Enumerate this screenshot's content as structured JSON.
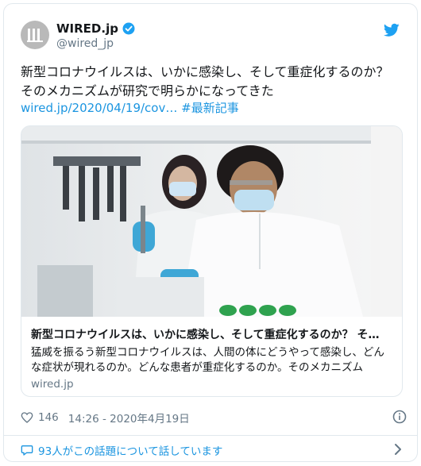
{
  "author": {
    "display_name": "WIRED.jp",
    "handle": "@wired_jp",
    "avatar_icon": "wired-logo-icon",
    "verified_icon": "verified-badge-icon"
  },
  "platform_icon": "twitter-bird-icon",
  "tweet": {
    "line1": "新型コロナウイルスは、いかに感染し、そして重症化するのか？",
    "line2": "そのメカニズムが研究で明らかになってきた",
    "link": "wired.jp/2020/04/19/cov…",
    "hashtag": "#最新記事"
  },
  "card": {
    "image_alt": "lab-researchers-photo",
    "title": "新型コロナウイルスは、いかに感染し、そして重症化するのか？ そ…",
    "description": "猛威を振るう新型コロナウイルスは、人間の体にどうやって感染し、どんな症状が現れるのか。どんな患者が重症化するのか。そのメカニズム",
    "domain": "wired.jp"
  },
  "meta": {
    "like_count": "146",
    "timestamp": "14:26 - 2020年4月19日"
  },
  "conversation": {
    "label": "93人がこの話題について話しています"
  },
  "colors": {
    "link": "#1b95e0",
    "muted": "#657786",
    "text": "#14171a",
    "border": "#e1e8ed"
  }
}
